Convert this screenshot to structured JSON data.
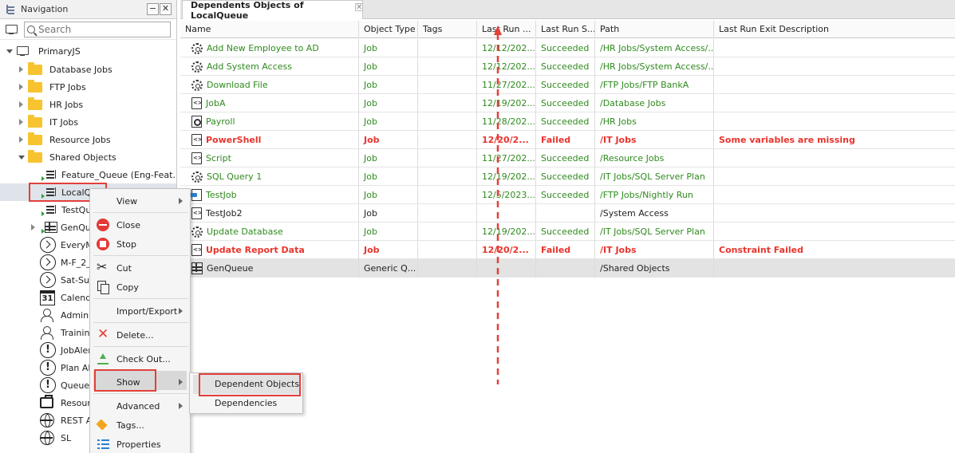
{
  "nav": {
    "title": "Navigation",
    "minimize": "−",
    "close": "✕",
    "search_placeholder": "Search",
    "tree": [
      {
        "label": "PrimaryJS"
      },
      {
        "label": "Database Jobs"
      },
      {
        "label": "FTP Jobs"
      },
      {
        "label": "HR Jobs"
      },
      {
        "label": "IT Jobs"
      },
      {
        "label": "Resource Jobs"
      },
      {
        "label": "Shared Objects"
      },
      {
        "label": "Feature_Queue (Eng-Feat..."
      },
      {
        "label": "LocalQu"
      },
      {
        "label": "TestQue"
      },
      {
        "label": "GenQue"
      },
      {
        "label": "EveryM"
      },
      {
        "label": "M-F_2_"
      },
      {
        "label": "Sat-Sun"
      },
      {
        "label": "Calenda"
      },
      {
        "label": "Admin"
      },
      {
        "label": "Training"
      },
      {
        "label": "JobAler"
      },
      {
        "label": "Plan Ale"
      },
      {
        "label": "QueueA"
      },
      {
        "label": "Resourc"
      },
      {
        "label": "REST A"
      },
      {
        "label": "SL"
      }
    ],
    "calendar_day": "31"
  },
  "tab": {
    "title": "Dependents Objects of LocalQueue",
    "close": "✕"
  },
  "grid": {
    "columns": [
      "Name",
      "Object Type",
      "Tags",
      "Last Run ...",
      "Last Run S...",
      "Path",
      "Last Run Exit Description"
    ],
    "rows": [
      {
        "name": "Add New Employee to AD",
        "type": "Job",
        "tags": "",
        "last_run": "12/12/202...",
        "status": "Succeeded",
        "path": "/HR Jobs/System Access/...",
        "exit": "",
        "style": "ok",
        "icon": "gear-icon"
      },
      {
        "name": "Add System Access",
        "type": "Job",
        "tags": "",
        "last_run": "12/12/202...",
        "status": "Succeeded",
        "path": "/HR Jobs/System Access/...",
        "exit": "",
        "style": "ok",
        "icon": "gear-icon"
      },
      {
        "name": "Download File",
        "type": "Job",
        "tags": "",
        "last_run": "11/27/202...",
        "status": "Succeeded",
        "path": "/FTP Jobs/FTP BankA",
        "exit": "",
        "style": "ok",
        "icon": "gear-icon"
      },
      {
        "name": "JobA",
        "type": "Job",
        "tags": "",
        "last_run": "12/19/202...",
        "status": "Succeeded",
        "path": "/Database Jobs",
        "exit": "",
        "style": "ok",
        "icon": "doc-icon"
      },
      {
        "name": "Payroll",
        "type": "Job",
        "tags": "",
        "last_run": "11/28/202...",
        "status": "Succeeded",
        "path": "/HR Jobs",
        "exit": "",
        "style": "ok",
        "icon": "docgear-icon"
      },
      {
        "name": "PowerShell",
        "type": "Job",
        "tags": "",
        "last_run": "12/20/2...",
        "status": "Failed",
        "path": "/IT Jobs",
        "exit": "Some variables are missing",
        "style": "fail",
        "icon": "doc-icon"
      },
      {
        "name": "Script",
        "type": "Job",
        "tags": "",
        "last_run": "11/27/202...",
        "status": "Succeeded",
        "path": "/Resource Jobs",
        "exit": "",
        "style": "ok",
        "icon": "doc-icon"
      },
      {
        "name": "SQL Query 1",
        "type": "Job",
        "tags": "",
        "last_run": "12/19/202...",
        "status": "Succeeded",
        "path": "/IT Jobs/SQL Server Plan",
        "exit": "",
        "style": "ok",
        "icon": "gear-icon"
      },
      {
        "name": "TestJob",
        "type": "Job",
        "tags": "",
        "last_run": "12/5/2023...",
        "status": "Succeeded",
        "path": "/FTP Jobs/Nightly Run",
        "exit": "",
        "style": "ok",
        "icon": "ftp-icon"
      },
      {
        "name": "TestJob2",
        "type": "Job",
        "tags": "",
        "last_run": "",
        "status": "",
        "path": "/System Access",
        "exit": "",
        "style": "plain",
        "icon": "doc-icon"
      },
      {
        "name": "Update Database",
        "type": "Job",
        "tags": "",
        "last_run": "12/19/202...",
        "status": "Succeeded",
        "path": "/IT Jobs/SQL Server Plan",
        "exit": "",
        "style": "ok",
        "icon": "gear-icon"
      },
      {
        "name": "Update Report Data",
        "type": "Job",
        "tags": "",
        "last_run": "12/20/2...",
        "status": "Failed",
        "path": "/IT Jobs",
        "exit": "Constraint Failed",
        "style": "fail",
        "icon": "doc-icon"
      },
      {
        "name": "GenQueue",
        "type": "Generic Q...",
        "tags": "",
        "last_run": "",
        "status": "",
        "path": "/Shared Objects",
        "exit": "",
        "style": "plain",
        "icon": "gq-icon"
      }
    ]
  },
  "context_menu": {
    "items": [
      {
        "label": "View",
        "submenu": true
      },
      {
        "label": "Close",
        "submenu": false
      },
      {
        "label": "Stop",
        "submenu": false
      },
      {
        "label": "Cut",
        "submenu": false
      },
      {
        "label": "Copy",
        "submenu": false
      },
      {
        "label": "Import/Export",
        "submenu": true
      },
      {
        "label": "Delete...",
        "submenu": false
      },
      {
        "label": "Check Out...",
        "submenu": false
      },
      {
        "label": "Show",
        "submenu": true
      },
      {
        "label": "Advanced",
        "submenu": true
      },
      {
        "label": "Tags...",
        "submenu": false
      },
      {
        "label": "Properties",
        "submenu": false
      }
    ]
  },
  "submenu": {
    "items": [
      {
        "label": "Dependent Objects"
      },
      {
        "label": "Dependencies"
      }
    ]
  },
  "colors": {
    "success": "#2f8a1e",
    "failed": "#e8352d",
    "highlight": "#e2403a"
  }
}
